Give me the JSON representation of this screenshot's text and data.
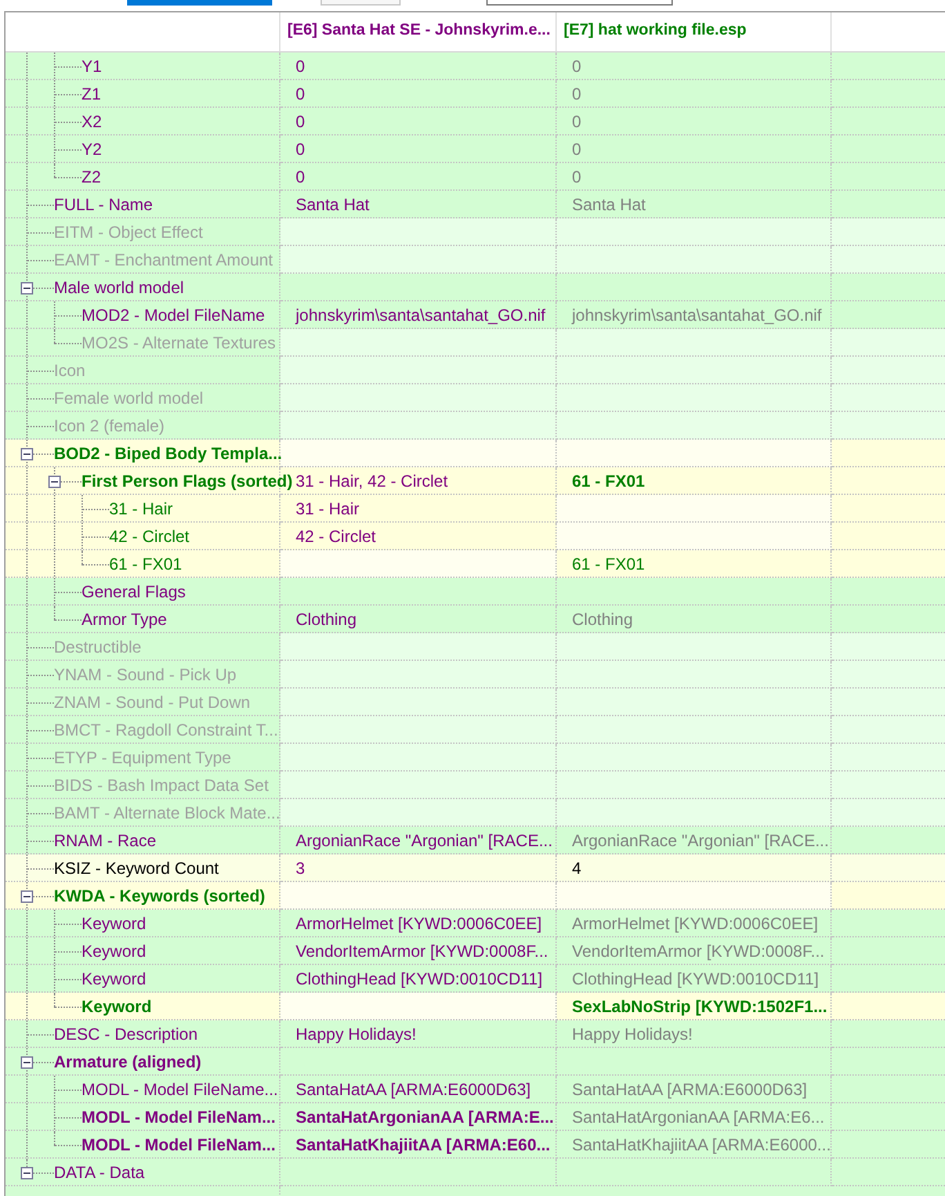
{
  "toolbar": [
    {
      "kind": "primary"
    },
    {
      "kind": "secondary"
    },
    {
      "kind": "field"
    }
  ],
  "columns": [
    {
      "text": "[E6] Santa Hat SE - Johnskyrim.e...",
      "kind": "base"
    },
    {
      "text": "[E7] hat working file.esp",
      "kind": "override"
    }
  ],
  "rows": [
    {
      "children": [
        {
          "kind": "match",
          "label": {
            "text": "Y1",
            "kind": "base"
          },
          "value_1": {
            "text": "0",
            "kind": "base"
          },
          "value_2": {
            "text": "0",
            "kind": "identical"
          }
        },
        {
          "kind": "match",
          "label": {
            "text": "Z1",
            "kind": "base"
          },
          "value_1": {
            "text": "0",
            "kind": "base"
          },
          "value_2": {
            "text": "0",
            "kind": "identical"
          }
        },
        {
          "kind": "match",
          "label": {
            "text": "X2",
            "kind": "base"
          },
          "value_1": {
            "text": "0",
            "kind": "base"
          },
          "value_2": {
            "text": "0",
            "kind": "identical"
          }
        },
        {
          "kind": "match",
          "label": {
            "text": "Y2",
            "kind": "base"
          },
          "value_1": {
            "text": "0",
            "kind": "base"
          },
          "value_2": {
            "text": "0",
            "kind": "identical"
          }
        },
        {
          "kind": "match",
          "label": {
            "text": "Z2",
            "kind": "base"
          },
          "value_1": {
            "text": "0",
            "kind": "base"
          },
          "value_2": {
            "text": "0",
            "kind": "identical"
          }
        }
      ]
    },
    {
      "kind": "match",
      "label": {
        "text": "FULL - Name",
        "kind": "base"
      },
      "value_1": {
        "text": "Santa Hat",
        "kind": "base"
      },
      "value_2": {
        "text": "Santa Hat",
        "kind": "identical"
      }
    },
    {
      "kind": "absent",
      "label": {
        "text": "EITM - Object Effect",
        "kind": "absent"
      }
    },
    {
      "kind": "absent",
      "label": {
        "text": "EAMT - Enchantment Amount",
        "kind": "absent"
      }
    },
    {
      "kind": "match",
      "label": {
        "text": "Male world model",
        "kind": "base"
      },
      "expanded": true,
      "children": [
        {
          "kind": "match",
          "label": {
            "text": "MOD2 - Model FileName",
            "kind": "base"
          },
          "value_1": {
            "text": "johnskyrim\\santa\\santahat_GO.nif",
            "kind": "base"
          },
          "value_2": {
            "text": "johnskyrim\\santa\\santahat_GO.nif",
            "kind": "identical"
          }
        },
        {
          "kind": "absent",
          "label": {
            "text": "MO2S - Alternate Textures",
            "kind": "absent"
          }
        }
      ]
    },
    {
      "kind": "absent",
      "label": {
        "text": "Icon",
        "kind": "absent"
      }
    },
    {
      "kind": "absent",
      "label": {
        "text": "Female world model",
        "kind": "absent"
      }
    },
    {
      "kind": "absent",
      "label": {
        "text": "Icon 2 (female)",
        "kind": "absent"
      }
    },
    {
      "kind": "conflict",
      "label": {
        "text": "BOD2 - Biped Body Templa...",
        "kind": "override",
        "bold": true
      },
      "expanded": true,
      "children": [
        {
          "kind": "conflict",
          "label": {
            "text": "First Person Flags (sorted)",
            "kind": "override",
            "bold": true
          },
          "expanded": true,
          "value_1": {
            "text": "31 - Hair, 42 - Circlet",
            "kind": "base"
          },
          "value_2": {
            "text": "61 - FX01",
            "kind": "override",
            "bold": true
          },
          "children": [
            {
              "kind": "conflict",
              "label": {
                "text": "31 - Hair",
                "kind": "override"
              },
              "value_1": {
                "text": "31 - Hair",
                "kind": "base"
              }
            },
            {
              "kind": "conflict",
              "label": {
                "text": "42 - Circlet",
                "kind": "override"
              },
              "value_1": {
                "text": "42 - Circlet",
                "kind": "base"
              }
            },
            {
              "kind": "conflict",
              "label": {
                "text": "61 - FX01",
                "kind": "override"
              },
              "value_2": {
                "text": "61 - FX01",
                "kind": "override"
              }
            }
          ]
        },
        {
          "kind": "match",
          "label": {
            "text": "General Flags",
            "kind": "base"
          }
        },
        {
          "kind": "match",
          "label": {
            "text": "Armor Type",
            "kind": "base"
          },
          "value_1": {
            "text": "Clothing",
            "kind": "base"
          },
          "value_2": {
            "text": "Clothing",
            "kind": "identical"
          }
        }
      ]
    },
    {
      "kind": "absent",
      "label": {
        "text": "Destructible",
        "kind": "absent"
      }
    },
    {
      "kind": "absent",
      "label": {
        "text": "YNAM - Sound - Pick Up",
        "kind": "absent"
      }
    },
    {
      "kind": "absent",
      "label": {
        "text": "ZNAM - Sound - Put Down",
        "kind": "absent"
      }
    },
    {
      "kind": "absent",
      "label": {
        "text": "BMCT - Ragdoll Constraint T...",
        "kind": "absent"
      }
    },
    {
      "kind": "absent",
      "label": {
        "text": "ETYP - Equipment Type",
        "kind": "absent"
      }
    },
    {
      "kind": "absent",
      "label": {
        "text": "BIDS - Bash Impact Data Set",
        "kind": "absent"
      }
    },
    {
      "kind": "absent",
      "label": {
        "text": "BAMT - Alternate Block Mate...",
        "kind": "absent"
      }
    },
    {
      "kind": "match",
      "label": {
        "text": "RNAM - Race",
        "kind": "base"
      },
      "value_1": {
        "text": "ArgonianRace \"Argonian\" [RACE...",
        "kind": "base"
      },
      "value_2": {
        "text": "ArgonianRace \"Argonian\" [RACE...",
        "kind": "identical"
      }
    },
    {
      "kind": "changed",
      "label": {
        "text": "KSIZ - Keyword Count",
        "kind": "plain"
      },
      "value_1": {
        "text": "3",
        "kind": "base"
      },
      "value_2": {
        "text": "4",
        "kind": "plain"
      }
    },
    {
      "kind": "conflict",
      "label": {
        "text": "KWDA - Keywords (sorted)",
        "kind": "override",
        "bold": true
      },
      "expanded": true,
      "children": [
        {
          "kind": "match",
          "label": {
            "text": "Keyword",
            "kind": "base"
          },
          "value_1": {
            "text": "ArmorHelmet [KYWD:0006C0EE]",
            "kind": "base"
          },
          "value_2": {
            "text": "ArmorHelmet [KYWD:0006C0EE]",
            "kind": "identical"
          }
        },
        {
          "kind": "match",
          "label": {
            "text": "Keyword",
            "kind": "base"
          },
          "value_1": {
            "text": "VendorItemArmor [KYWD:0008F...",
            "kind": "base"
          },
          "value_2": {
            "text": "VendorItemArmor [KYWD:0008F...",
            "kind": "identical"
          }
        },
        {
          "kind": "match",
          "label": {
            "text": "Keyword",
            "kind": "base"
          },
          "value_1": {
            "text": "ClothingHead [KYWD:0010CD11]",
            "kind": "base"
          },
          "value_2": {
            "text": "ClothingHead [KYWD:0010CD11]",
            "kind": "identical"
          }
        },
        {
          "kind": "conflict",
          "label": {
            "text": "Keyword",
            "kind": "override",
            "bold": true
          },
          "value_2": {
            "text": "SexLabNoStrip [KYWD:1502F1...",
            "kind": "override",
            "bold": true
          }
        }
      ]
    },
    {
      "kind": "match",
      "label": {
        "text": "DESC - Description",
        "kind": "base"
      },
      "value_1": {
        "text": "Happy Holidays!",
        "kind": "base"
      },
      "value_2": {
        "text": "Happy Holidays!",
        "kind": "identical"
      }
    },
    {
      "kind": "match",
      "label": {
        "text": "Armature (aligned)",
        "kind": "base",
        "bold": true
      },
      "expanded": true,
      "children": [
        {
          "kind": "match",
          "label": {
            "text": "MODL - Model FileName...",
            "kind": "base"
          },
          "value_1": {
            "text": "SantaHatAA [ARMA:E6000D63]",
            "kind": "base"
          },
          "value_2": {
            "text": "SantaHatAA [ARMA:E6000D63]",
            "kind": "identical"
          }
        },
        {
          "kind": "match",
          "label": {
            "text": "MODL - Model FileNam...",
            "kind": "base",
            "bold": true
          },
          "value_1": {
            "text": "SantaHatArgonianAA [ARMA:E...",
            "kind": "base",
            "bold": true
          },
          "value_2": {
            "text": "SantaHatArgonianAA [ARMA:E6...",
            "kind": "identical"
          }
        },
        {
          "kind": "match",
          "label": {
            "text": "MODL - Model FileNam...",
            "kind": "base",
            "bold": true
          },
          "value_1": {
            "text": "SantaHatKhajiitAA [ARMA:E60...",
            "kind": "base",
            "bold": true
          },
          "value_2": {
            "text": "SantaHatKhajiitAA [ARMA:E6000...",
            "kind": "identical"
          }
        }
      ]
    },
    {
      "kind": "match",
      "label": {
        "text": "DATA - Data",
        "kind": "base"
      },
      "expanded": true
    }
  ]
}
